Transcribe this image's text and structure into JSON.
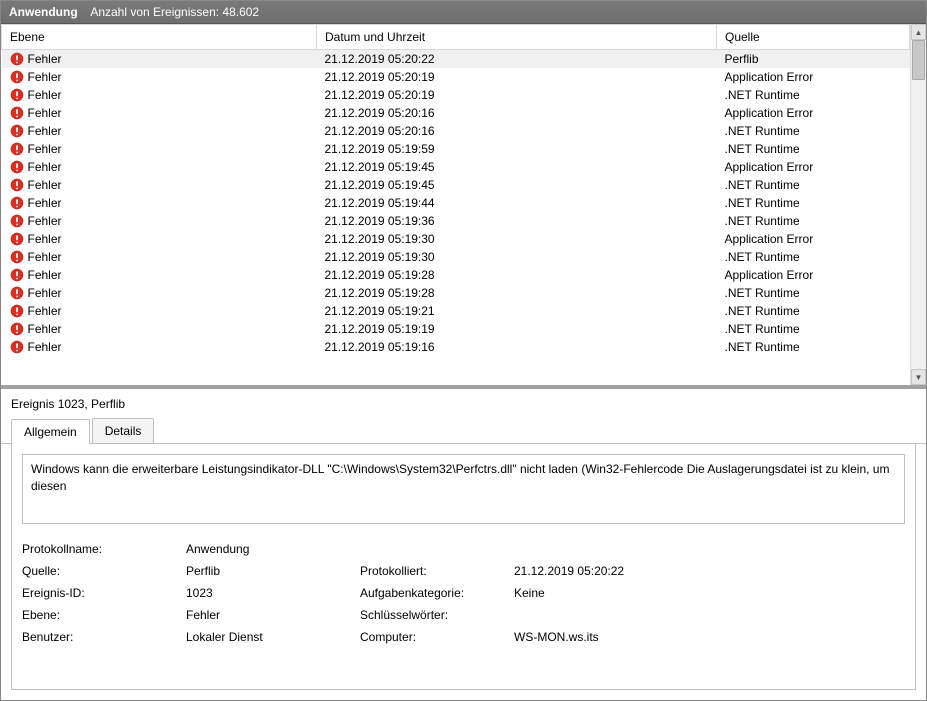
{
  "header": {
    "app_label": "Anwendung",
    "count_label": "Anzahl von Ereignissen: 48.602"
  },
  "columns": {
    "level": "Ebene",
    "datetime": "Datum und Uhrzeit",
    "source": "Quelle"
  },
  "level_text": "Fehler",
  "rows": [
    {
      "dt": "21.12.2019 05:20:22",
      "src": "Perflib",
      "selected": true
    },
    {
      "dt": "21.12.2019 05:20:19",
      "src": "Application Error"
    },
    {
      "dt": "21.12.2019 05:20:19",
      "src": ".NET Runtime"
    },
    {
      "dt": "21.12.2019 05:20:16",
      "src": "Application Error"
    },
    {
      "dt": "21.12.2019 05:20:16",
      "src": ".NET Runtime"
    },
    {
      "dt": "21.12.2019 05:19:59",
      "src": ".NET Runtime"
    },
    {
      "dt": "21.12.2019 05:19:45",
      "src": "Application Error"
    },
    {
      "dt": "21.12.2019 05:19:45",
      "src": ".NET Runtime"
    },
    {
      "dt": "21.12.2019 05:19:44",
      "src": ".NET Runtime"
    },
    {
      "dt": "21.12.2019 05:19:36",
      "src": ".NET Runtime"
    },
    {
      "dt": "21.12.2019 05:19:30",
      "src": "Application Error"
    },
    {
      "dt": "21.12.2019 05:19:30",
      "src": ".NET Runtime"
    },
    {
      "dt": "21.12.2019 05:19:28",
      "src": "Application Error"
    },
    {
      "dt": "21.12.2019 05:19:28",
      "src": ".NET Runtime"
    },
    {
      "dt": "21.12.2019 05:19:21",
      "src": ".NET Runtime"
    },
    {
      "dt": "21.12.2019 05:19:19",
      "src": ".NET Runtime"
    },
    {
      "dt": "21.12.2019 05:19:16",
      "src": ".NET Runtime"
    }
  ],
  "detail": {
    "title": "Ereignis 1023, Perflib",
    "tabs": {
      "general": "Allgemein",
      "details": "Details"
    },
    "message": "Windows kann die erweiterbare Leistungsindikator-DLL \"C:\\Windows\\System32\\Perfctrs.dll\" nicht laden (Win32-Fehlercode Die Auslagerungsdatei ist zu klein, um diesen",
    "labels": {
      "logname": "Protokollname:",
      "source": "Quelle:",
      "logged": "Protokolliert:",
      "eventid": "Ereignis-ID:",
      "category": "Aufgabenkategorie:",
      "level": "Ebene:",
      "keywords": "Schlüsselwörter:",
      "user": "Benutzer:",
      "computer": "Computer:"
    },
    "values": {
      "logname": "Anwendung",
      "source": "Perflib",
      "logged": "21.12.2019 05:20:22",
      "eventid": "1023",
      "category": "Keine",
      "level": "Fehler",
      "keywords": "",
      "user": "Lokaler Dienst",
      "computer": "WS-MON.ws.its"
    }
  }
}
